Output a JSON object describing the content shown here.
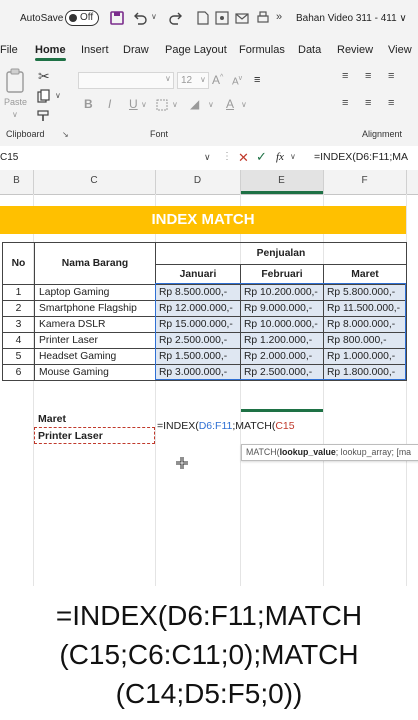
{
  "titlebar": {
    "autosave_label": "AutoSave",
    "autosave_state": "Off",
    "doc_title": "Bahan Video 311 - 411 ∨"
  },
  "menu": [
    "File",
    "Home",
    "Insert",
    "Draw",
    "Page Layout",
    "Formulas",
    "Data",
    "Review",
    "View"
  ],
  "ribbon": {
    "paste_label": "Paste",
    "font_size": "12",
    "bold": "B",
    "italic": "I",
    "underline": "U",
    "clipboard_label": "Clipboard",
    "font_label": "Font",
    "alignment_label": "Alignment"
  },
  "formula_bar": {
    "name_box": "C15",
    "fx": "fx",
    "formula": "=INDEX(D6:F11;MA"
  },
  "columns": [
    "B",
    "C",
    "D",
    "E",
    "F"
  ],
  "sheet": {
    "banner": "INDEX MATCH",
    "header_no": "No",
    "header_nama": "Nama Barang",
    "header_penjualan": "Penjualan",
    "months": [
      "Januari",
      "Februari",
      "Maret"
    ],
    "rows": [
      {
        "no": "1",
        "nama": "Laptop Gaming",
        "jan": "Rp 8.500.000,-",
        "feb": "Rp 10.200.000,-",
        "mar": "Rp 5.800.000,-"
      },
      {
        "no": "2",
        "nama": "Smartphone Flagship",
        "jan": "Rp 12.000.000,-",
        "feb": "Rp 9.000.000,-",
        "mar": "Rp 11.500.000,-"
      },
      {
        "no": "3",
        "nama": "Kamera DSLR",
        "jan": "Rp 15.000.000,-",
        "feb": "Rp 10.000.000,-",
        "mar": "Rp 8.000.000,-"
      },
      {
        "no": "4",
        "nama": "Printer Laser",
        "jan": "Rp 2.500.000,-",
        "feb": "Rp 1.200.000,-",
        "mar": "Rp 800.000,-"
      },
      {
        "no": "5",
        "nama": "Headset Gaming",
        "jan": "Rp 1.500.000,-",
        "feb": "Rp 2.000.000,-",
        "mar": "Rp 1.000.000,-"
      },
      {
        "no": "6",
        "nama": "Mouse Gaming",
        "jan": "Rp 3.000.000,-",
        "feb": "Rp 2.500.000,-",
        "mar": "Rp 1.800.000,-"
      }
    ],
    "lookup_month": "Maret",
    "lookup_item": "Printer Laser",
    "edit_formula": {
      "p1": "=INDEX(",
      "p2": "D6:F11",
      "p3": ";MATCH(",
      "p4": "C15"
    },
    "tooltip": {
      "fn": "MATCH(",
      "arg1": "lookup_value",
      "rest": "; lookup_array; [ma"
    }
  },
  "caption": {
    "line1": "=INDEX(D6:F11;MATCH",
    "line2": "(C15;C6:C11;0);MATCH",
    "line3": "(C14;D5:F5;0))"
  },
  "colors": {
    "accent": "#1e7145",
    "banner": "#ffc000",
    "ref_blue": "#2e6fd3",
    "ref_red": "#c0392b"
  }
}
